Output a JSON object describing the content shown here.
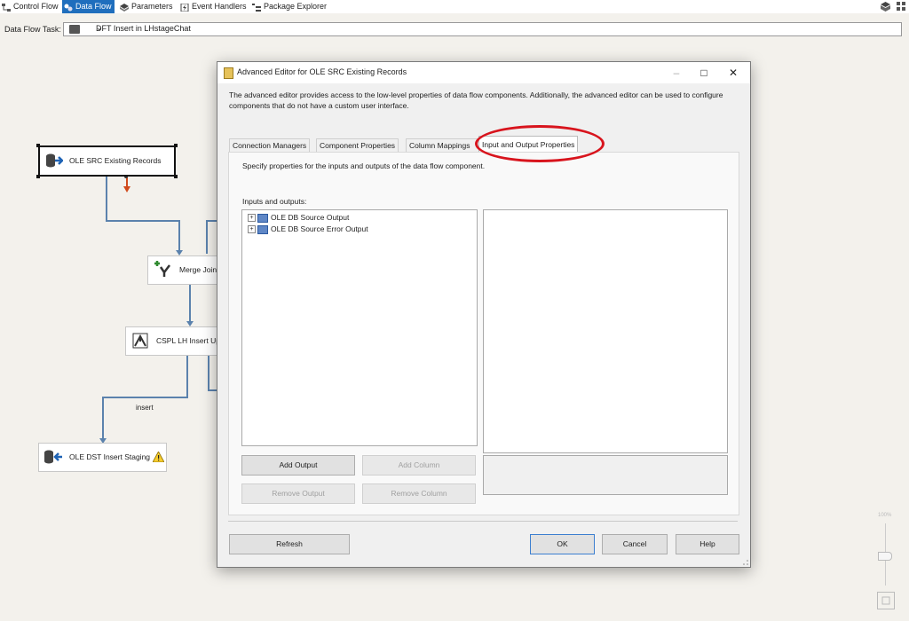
{
  "top_tabs": [
    {
      "label": "Control Flow",
      "icon": "control-flow-icon",
      "active": false
    },
    {
      "label": "Data Flow",
      "icon": "data-flow-icon",
      "active": true
    },
    {
      "label": "Parameters",
      "icon": "parameters-icon",
      "active": false
    },
    {
      "label": "Event Handlers",
      "icon": "event-handlers-icon",
      "active": false
    },
    {
      "label": "Package Explorer",
      "icon": "package-explorer-icon",
      "active": false
    }
  ],
  "task_bar": {
    "label": "Data Flow Task:",
    "selected": "DFT Insert in LHstageChat"
  },
  "canvas": {
    "components": [
      {
        "label": "OLE SRC Existing Records"
      },
      {
        "label": "Merge Join"
      },
      {
        "label": "CSPL LH Insert Upd"
      },
      {
        "label": "OLE DST Insert Staging"
      }
    ],
    "path_label": "insert",
    "zoom_level": "100%"
  },
  "dialog": {
    "title": "Advanced Editor for OLE SRC Existing Records",
    "description": "The advanced editor provides access to the low-level properties of data flow components. Additionally, the advanced editor can be used to configure components that do not have a custom user interface.",
    "tabs": [
      {
        "label": "Connection Managers"
      },
      {
        "label": "Component Properties"
      },
      {
        "label": "Column Mappings"
      },
      {
        "label": "Input and Output Properties",
        "active": true
      }
    ],
    "panel_hint": "Specify properties for the inputs and outputs of the data flow component.",
    "io_label": "Inputs and outputs:",
    "tree_items": [
      {
        "label": "OLE DB Source Output"
      },
      {
        "label": "OLE DB Source Error Output"
      }
    ],
    "buttons": {
      "add_output": "Add Output",
      "add_column": "Add Column",
      "remove_output": "Remove Output",
      "remove_column": "Remove Column",
      "refresh": "Refresh",
      "ok": "OK",
      "cancel": "Cancel",
      "help": "Help"
    }
  },
  "colors": {
    "active_tab": "#1f6ebd",
    "flow_path": "#5b82ad",
    "highlight": "#d8141d",
    "error_path": "#d04a1c"
  }
}
